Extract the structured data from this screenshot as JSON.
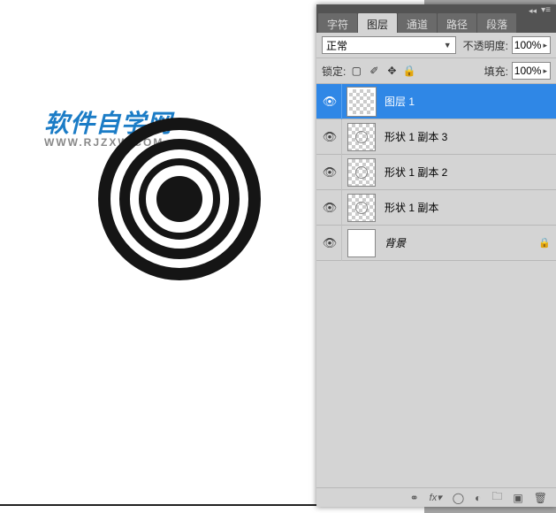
{
  "watermark": {
    "title": "软件自学网",
    "url": "WWW.RJZXW.COM"
  },
  "tabs": {
    "char": "字符",
    "layers": "图层",
    "channels": "通道",
    "paths": "路径",
    "paragraph": "段落"
  },
  "options": {
    "blend_mode": "正常",
    "opacity_label": "不透明度:",
    "opacity_value": "100%",
    "lock_label": "锁定:",
    "fill_label": "填充:",
    "fill_value": "100%"
  },
  "icons": {
    "lock_transparent": "▢",
    "lock_brush": "✐",
    "lock_move": "✥",
    "lock_all": "🔒"
  },
  "layers": [
    {
      "name": "图层 1",
      "visible": true,
      "selected": true,
      "thumb": "checker",
      "locked": false
    },
    {
      "name": "形状 1 副本 3",
      "visible": true,
      "selected": false,
      "thumb": "ring",
      "locked": false
    },
    {
      "name": "形状 1 副本 2",
      "visible": true,
      "selected": false,
      "thumb": "ring",
      "locked": false
    },
    {
      "name": "形状 1 副本",
      "visible": true,
      "selected": false,
      "thumb": "ring",
      "locked": false
    },
    {
      "name": "背景",
      "visible": true,
      "selected": false,
      "thumb": "white",
      "locked": true,
      "italic": true
    }
  ],
  "footer_icons": {
    "link": "⚭",
    "fx": "fx▾",
    "mask": "◯",
    "adjust": "◐",
    "folder": "🗀",
    "new": "▣",
    "trash": "🗑"
  }
}
